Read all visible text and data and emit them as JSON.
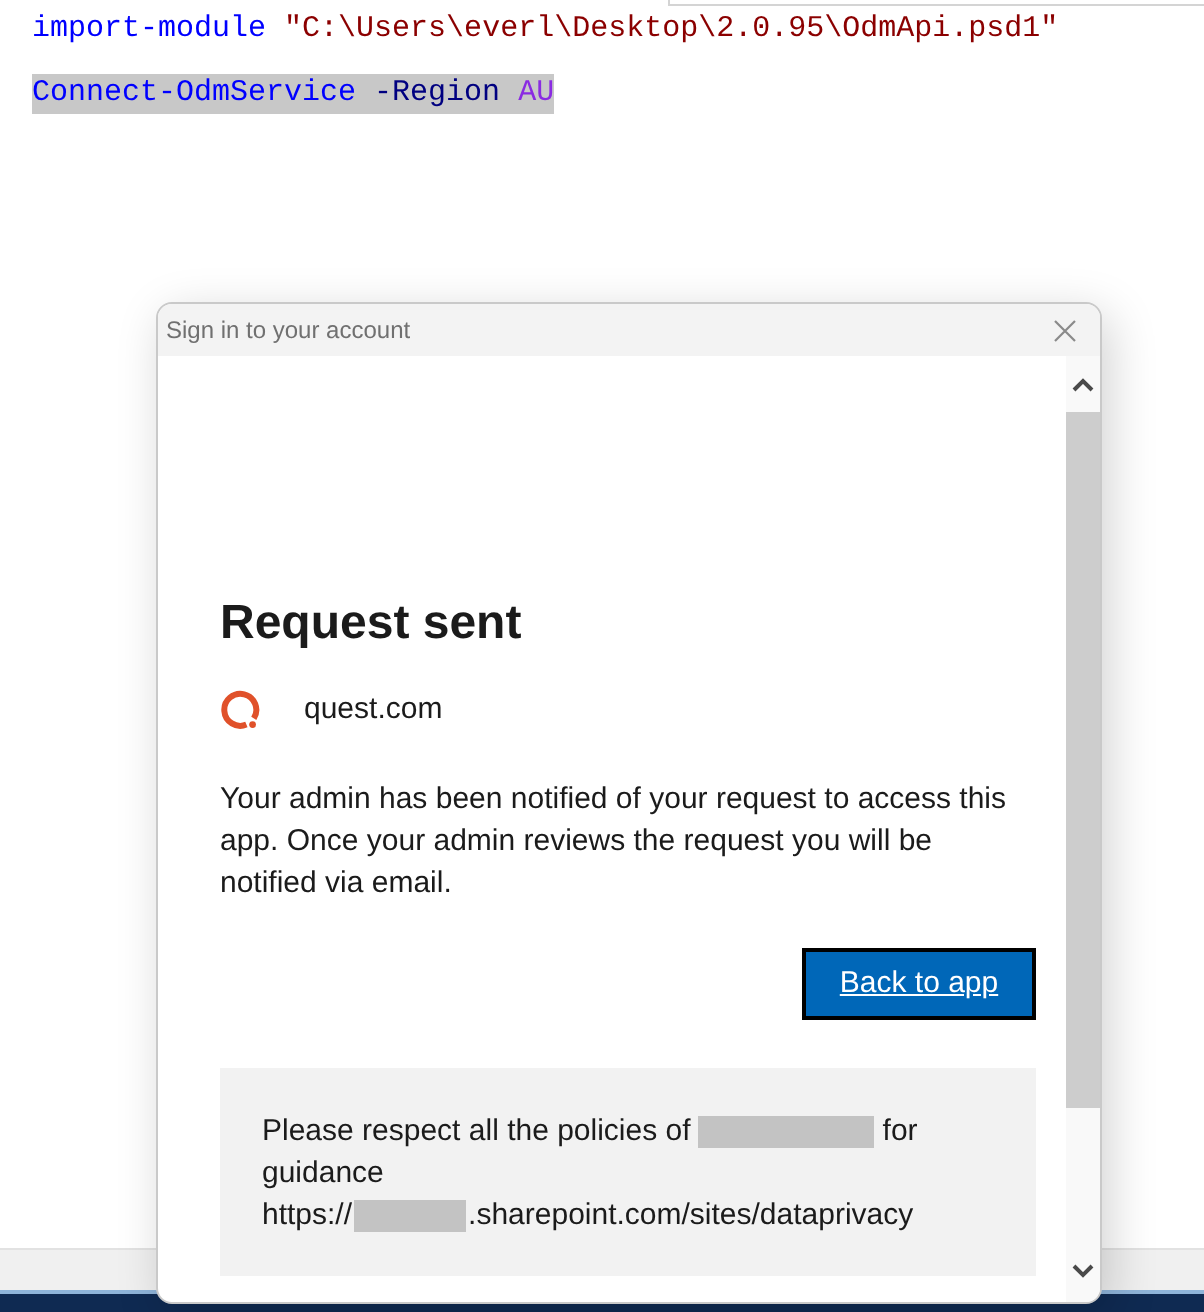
{
  "editor": {
    "lines": [
      {
        "selected": false,
        "tokens": [
          {
            "kind": "keyword",
            "text": "import-module"
          },
          {
            "kind": "string",
            "text": "\"C:\\Users\\everl\\Desktop\\2.0.95\\OdmApi.psd1\""
          }
        ]
      },
      {
        "selected": true,
        "tokens": [
          {
            "kind": "command",
            "text": "Connect-OdmService"
          },
          {
            "kind": "parameter",
            "text": "-Region"
          },
          {
            "kind": "value",
            "text": "AU"
          }
        ]
      }
    ]
  },
  "dialog": {
    "title": "Sign in to your account",
    "heading": "Request sent",
    "brand": {
      "domain": "quest.com"
    },
    "message": "Your admin has been notified of your request to access this app. Once your admin reviews the request you will be notified via email.",
    "button": {
      "label": "Back to app",
      "focused": true
    },
    "notice": {
      "lines": [
        [
          {
            "kind": "text",
            "text": "Please respect all the policies of"
          },
          {
            "kind": "redacted"
          },
          {
            "kind": "text",
            "text": "for"
          }
        ],
        [
          {
            "kind": "text",
            "text": "guidance"
          }
        ],
        [
          {
            "kind": "text",
            "text": "https://"
          },
          {
            "kind": "redacted"
          },
          {
            "kind": "text",
            "text": ".sharepoint.com/sites/dataprivacy"
          }
        ]
      ]
    }
  }
}
